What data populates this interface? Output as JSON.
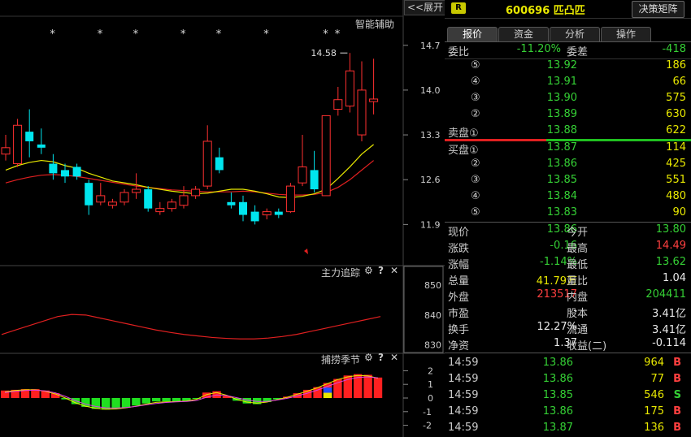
{
  "toolbar": {
    "expand_label": "<<展开",
    "smart_assist": "智能辅助"
  },
  "stock": {
    "badge": "R",
    "code_name": "600696 匹凸匹",
    "decision_button": "决策矩阵"
  },
  "tabs": [
    "报价",
    "资金",
    "分析",
    "操作"
  ],
  "price_axis": {
    "ticks": [
      "14.7",
      "14.0",
      "13.3",
      "12.6",
      "11.9"
    ],
    "max_label": "14.58"
  },
  "indicator1": {
    "title": "主力追踪",
    "ticks": [
      "850",
      "840",
      "830"
    ]
  },
  "indicator2": {
    "title": "捕捞季节",
    "ticks": [
      "2",
      "1",
      "0",
      "-1",
      "-2"
    ]
  },
  "icons": {
    "gear": "⚙",
    "help": "?",
    "close": "✕"
  },
  "quote_top": {
    "wb_label": "委比",
    "wb_value": "-11.20%",
    "wc_label": "委差",
    "wc_value": "-418"
  },
  "sell_book": [
    {
      "idx": "⑤",
      "price": "13.92",
      "vol": "186"
    },
    {
      "idx": "④",
      "price": "13.91",
      "vol": "66"
    },
    {
      "idx": "③",
      "price": "13.90",
      "vol": "575"
    },
    {
      "idx": "②",
      "price": "13.89",
      "vol": "630"
    },
    {
      "idx": "卖盘①",
      "price": "13.88",
      "vol": "622"
    }
  ],
  "buy_book": [
    {
      "idx": "买盘①",
      "price": "13.87",
      "vol": "114"
    },
    {
      "idx": "②",
      "price": "13.86",
      "vol": "425"
    },
    {
      "idx": "③",
      "price": "13.85",
      "vol": "551"
    },
    {
      "idx": "④",
      "price": "13.84",
      "vol": "480"
    },
    {
      "idx": "⑤",
      "price": "13.83",
      "vol": "90"
    }
  ],
  "stats": [
    {
      "l1": "现价",
      "v1": "13.86",
      "c1": "green",
      "l2": "今开",
      "v2": "13.80",
      "c2": "green"
    },
    {
      "l1": "涨跌",
      "v1": "-0.16",
      "c1": "green",
      "l2": "最高",
      "v2": "14.49",
      "c2": "red"
    },
    {
      "l1": "涨幅",
      "v1": "-1.14%",
      "c1": "green",
      "l2": "最低",
      "v2": "13.62",
      "c2": "green"
    },
    {
      "l1": "总量",
      "v1": "41.79万",
      "c1": "yellow",
      "l2": "量比",
      "v2": "1.04",
      "c2": "white"
    },
    {
      "l1": "外盘",
      "v1": "213517",
      "c1": "red",
      "l2": "内盘",
      "v2": "204411",
      "c2": "green"
    },
    {
      "l1": "市盈",
      "v1": "-",
      "c1": "white",
      "l2": "股本",
      "v2": "3.41亿",
      "c2": "white"
    },
    {
      "l1": "换手",
      "v1": "12.27%",
      "c1": "white",
      "l2": "流通",
      "v2": "3.41亿",
      "c2": "white"
    },
    {
      "l1": "净资",
      "v1": "1.37",
      "c1": "white",
      "l2": "收益(二)",
      "v2": "-0.114",
      "c2": "white"
    }
  ],
  "trades": [
    {
      "time": "14:59",
      "price": "13.86",
      "qty": "964",
      "side": "B"
    },
    {
      "time": "14:59",
      "price": "13.86",
      "qty": "77",
      "side": "B"
    },
    {
      "time": "14:59",
      "price": "13.85",
      "qty": "546",
      "side": "S"
    },
    {
      "time": "14:59",
      "price": "13.86",
      "qty": "175",
      "side": "B"
    },
    {
      "time": "14:59",
      "price": "13.87",
      "qty": "136",
      "side": "B"
    }
  ],
  "colors": {
    "up": "#ff3030",
    "down": "#00e5ee",
    "ma_short": "#e8e800",
    "ma_long": "#e02020",
    "green": "#35d035"
  },
  "chart_data": [
    {
      "type": "candlestick",
      "title": "",
      "ylim": [
        11.6,
        14.9
      ],
      "y_ticks": [
        14.7,
        14.0,
        13.3,
        12.6,
        11.9
      ],
      "annotation": "14.58",
      "candles": [
        {
          "o": 13.0,
          "c": 13.1,
          "h": 13.3,
          "l": 12.9
        },
        {
          "o": 12.85,
          "c": 13.45,
          "h": 13.55,
          "l": 12.8
        },
        {
          "o": 13.35,
          "c": 13.2,
          "h": 13.7,
          "l": 12.95
        },
        {
          "o": 13.15,
          "c": 13.1,
          "h": 13.4,
          "l": 13.0
        },
        {
          "o": 12.85,
          "c": 12.7,
          "h": 13.0,
          "l": 12.6
        },
        {
          "o": 12.75,
          "c": 12.65,
          "h": 12.85,
          "l": 12.55
        },
        {
          "o": 12.8,
          "c": 12.65,
          "h": 12.85,
          "l": 12.6
        },
        {
          "o": 12.55,
          "c": 12.2,
          "h": 12.6,
          "l": 12.05
        },
        {
          "o": 12.25,
          "c": 12.35,
          "h": 12.55,
          "l": 12.2
        },
        {
          "o": 12.2,
          "c": 12.25,
          "h": 12.3,
          "l": 12.15
        },
        {
          "o": 12.25,
          "c": 12.4,
          "h": 12.45,
          "l": 12.2
        },
        {
          "o": 12.4,
          "c": 12.45,
          "h": 12.7,
          "l": 12.3
        },
        {
          "o": 12.45,
          "c": 12.15,
          "h": 12.5,
          "l": 12.1
        },
        {
          "o": 12.1,
          "c": 12.15,
          "h": 12.25,
          "l": 12.05
        },
        {
          "o": 12.15,
          "c": 12.25,
          "h": 12.3,
          "l": 12.1
        },
        {
          "o": 12.2,
          "c": 12.35,
          "h": 12.5,
          "l": 12.15
        },
        {
          "o": 12.35,
          "c": 12.45,
          "h": 12.5,
          "l": 12.3
        },
        {
          "o": 12.5,
          "c": 13.2,
          "h": 13.45,
          "l": 12.45
        },
        {
          "o": 12.95,
          "c": 12.75,
          "h": 13.1,
          "l": 12.7
        },
        {
          "o": 12.25,
          "c": 12.2,
          "h": 12.4,
          "l": 12.15
        },
        {
          "o": 12.25,
          "c": 12.05,
          "h": 12.35,
          "l": 11.95
        },
        {
          "o": 12.1,
          "c": 11.95,
          "h": 12.2,
          "l": 11.9
        },
        {
          "o": 12.05,
          "c": 12.1,
          "h": 12.15,
          "l": 11.98
        },
        {
          "o": 12.1,
          "c": 12.05,
          "h": 12.15,
          "l": 12.0
        },
        {
          "o": 12.1,
          "c": 12.5,
          "h": 12.55,
          "l": 12.08
        },
        {
          "o": 12.55,
          "c": 12.8,
          "h": 13.3,
          "l": 12.5
        },
        {
          "o": 12.75,
          "c": 12.45,
          "h": 13.05,
          "l": 12.4
        },
        {
          "o": 12.35,
          "c": 13.6,
          "h": 13.6,
          "l": 12.35
        },
        {
          "o": 13.7,
          "c": 13.85,
          "h": 14.05,
          "l": 13.6
        },
        {
          "o": 13.75,
          "c": 14.3,
          "h": 14.58,
          "l": 13.65
        },
        {
          "o": 13.3,
          "c": 14.0,
          "h": 14.45,
          "l": 13.2
        },
        {
          "o": 13.82,
          "c": 13.86,
          "h": 14.49,
          "l": 13.62
        }
      ],
      "ma_short": [
        12.75,
        12.82,
        12.87,
        12.9,
        12.88,
        12.82,
        12.78,
        12.7,
        12.64,
        12.58,
        12.55,
        12.52,
        12.48,
        12.45,
        12.42,
        12.4,
        12.38,
        12.39,
        12.42,
        12.45,
        12.45,
        12.42,
        12.38,
        12.33,
        12.32,
        12.34,
        12.38,
        12.45,
        12.62,
        12.8,
        13.0,
        13.15
      ],
      "ma_long": [
        12.55,
        12.6,
        12.64,
        12.67,
        12.68,
        12.67,
        12.65,
        12.62,
        12.59,
        12.56,
        12.53,
        12.5,
        12.48,
        12.46,
        12.44,
        12.43,
        12.42,
        12.41,
        12.41,
        12.41,
        12.42,
        12.41,
        12.39,
        12.37,
        12.36,
        12.36,
        12.37,
        12.4,
        12.48,
        12.6,
        12.75,
        12.9
      ],
      "signals_star": [
        4,
        8,
        11,
        15,
        18,
        22,
        27,
        28
      ],
      "signal_arrow": 25
    },
    {
      "type": "line",
      "title": "主力追踪",
      "ylim": [
        828,
        853
      ],
      "y_ticks": [
        850,
        840,
        830
      ],
      "series": [
        {
          "values": [
            833.5,
            835,
            836.5,
            838,
            839.5,
            840.2,
            840,
            839,
            838,
            837,
            836,
            835,
            834.2,
            833.5,
            833,
            832.5,
            832.2,
            832,
            832,
            832.3,
            832.8,
            833.5,
            834.5,
            835.5,
            836.5,
            837.5,
            838.5,
            839.5
          ]
        }
      ]
    },
    {
      "type": "bar",
      "title": "捕捞季节",
      "ylim": [
        -2.5,
        2.5
      ],
      "y_ticks": [
        2,
        1,
        0,
        -1,
        -2
      ],
      "values": [
        0.55,
        0.6,
        0.65,
        0.65,
        0.55,
        0.35,
        -0.1,
        -0.45,
        -0.65,
        -0.8,
        -0.85,
        -0.8,
        -0.7,
        -0.55,
        -0.4,
        -0.25,
        -0.25,
        -0.25,
        -0.2,
        -0.05,
        0.4,
        0.5,
        0.15,
        -0.2,
        -0.4,
        -0.45,
        -0.3,
        -0.1,
        0.1,
        0.35,
        0.6,
        0.8,
        1.1,
        1.4,
        1.65,
        1.75,
        1.7,
        1.5
      ],
      "line1": [
        0.45,
        0.55,
        0.6,
        0.6,
        0.5,
        0.3,
        0.0,
        -0.35,
        -0.6,
        -0.75,
        -0.82,
        -0.8,
        -0.72,
        -0.6,
        -0.45,
        -0.32,
        -0.28,
        -0.26,
        -0.22,
        -0.1,
        0.25,
        0.4,
        0.2,
        -0.1,
        -0.3,
        -0.38,
        -0.3,
        -0.12,
        0.05,
        0.28,
        0.5,
        0.75,
        1.05,
        1.35,
        1.55,
        1.65,
        1.62,
        1.45
      ],
      "line2": [
        0.4,
        0.48,
        0.55,
        0.58,
        0.52,
        0.38,
        0.12,
        -0.2,
        -0.45,
        -0.62,
        -0.72,
        -0.74,
        -0.7,
        -0.62,
        -0.5,
        -0.4,
        -0.33,
        -0.28,
        -0.25,
        -0.18,
        0.05,
        0.22,
        0.18,
        0.02,
        -0.15,
        -0.25,
        -0.25,
        -0.15,
        -0.02,
        0.15,
        0.35,
        0.58,
        0.85,
        1.12,
        1.35,
        1.5,
        1.55,
        1.48
      ]
    }
  ]
}
